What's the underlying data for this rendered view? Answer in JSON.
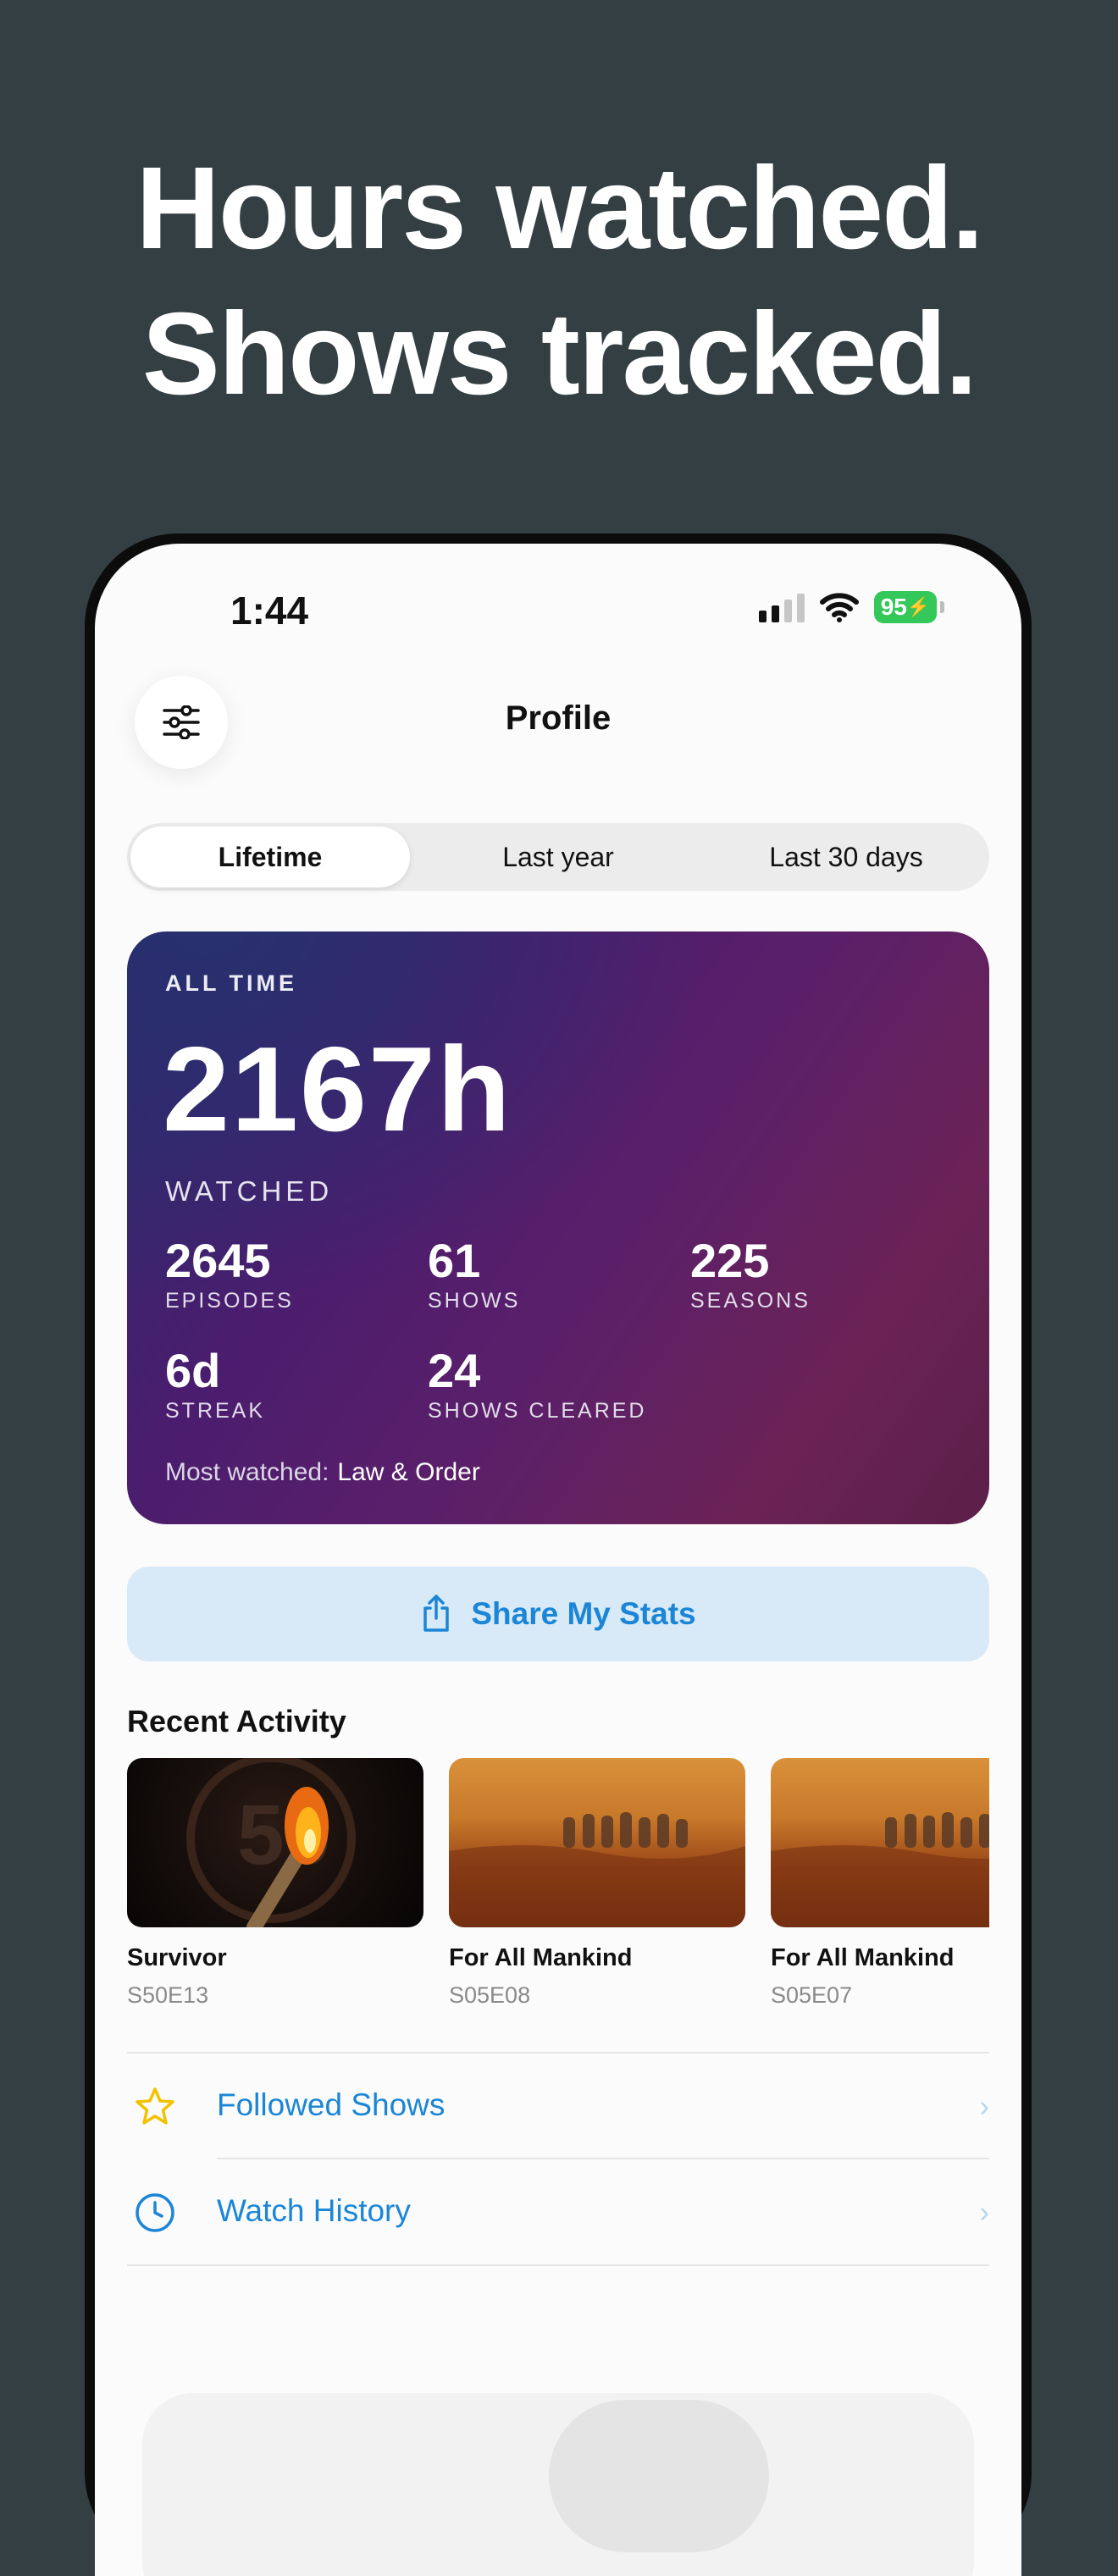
{
  "headline": {
    "line1": "Hours watched.",
    "line2": "Shows tracked."
  },
  "status_bar": {
    "time": "1:44",
    "battery": "95"
  },
  "nav": {
    "title": "Profile",
    "filter_icon": "sliders-icon"
  },
  "segments": [
    {
      "label": "Lifetime",
      "active": true
    },
    {
      "label": "Last year",
      "active": false
    },
    {
      "label": "Last 30 days",
      "active": false
    }
  ],
  "stats": {
    "period_label": "ALL TIME",
    "hours": "2167h",
    "hours_caption": "WATCHED",
    "episodes": {
      "value": "2645",
      "label": "EPISODES"
    },
    "shows": {
      "value": "61",
      "label": "SHOWS"
    },
    "seasons": {
      "value": "225",
      "label": "SEASONS"
    },
    "streak": {
      "value": "6d",
      "label": "STREAK"
    },
    "cleared": {
      "value": "24",
      "label": "SHOWS CLEARED"
    },
    "most_watched_label": "Most watched:",
    "most_watched_value": "Law & Order"
  },
  "share": {
    "label": "Share My Stats",
    "icon": "share-icon"
  },
  "recent_activity": {
    "title": "Recent Activity",
    "items": [
      {
        "title": "Survivor",
        "episode": "S50E13"
      },
      {
        "title": "For All Mankind",
        "episode": "S05E08"
      },
      {
        "title": "For All Mankind",
        "episode": "S05E07"
      }
    ]
  },
  "links": [
    {
      "label": "Followed Shows",
      "icon": "star-icon"
    },
    {
      "label": "Watch History",
      "icon": "clock-icon"
    }
  ],
  "colors": {
    "accent": "#1b86d6",
    "background": "#333f42",
    "battery": "#34c759",
    "star": "#f2c200"
  }
}
